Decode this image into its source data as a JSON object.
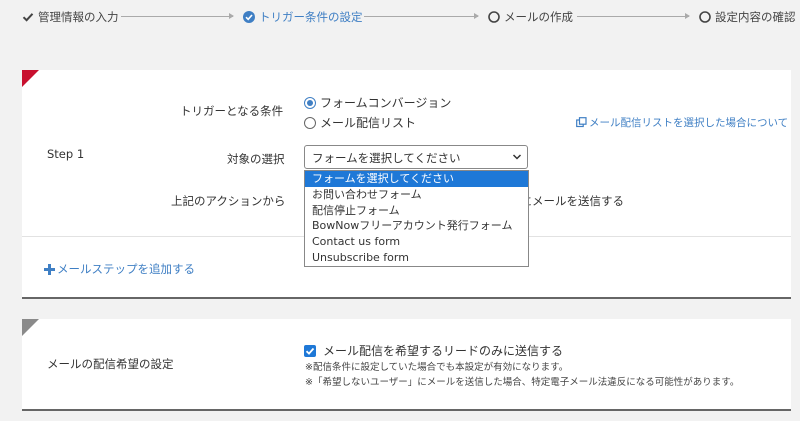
{
  "steps": [
    {
      "label": "管理情報の入力",
      "state": "done",
      "icon": "check-icon"
    },
    {
      "label": "トリガー条件の設定",
      "state": "active",
      "icon": "check-circle-icon"
    },
    {
      "label": "メールの作成",
      "state": "pending",
      "icon": "circle-icon"
    },
    {
      "label": "設定内容の確認",
      "state": "pending",
      "icon": "circle-icon"
    }
  ],
  "step_card": {
    "step_label": "Step 1",
    "trigger_label": "トリガーとなる条件",
    "radio_options": [
      {
        "label": "フォームコンバージョン",
        "checked": true
      },
      {
        "label": "メール配信リスト",
        "checked": false
      }
    ],
    "list_help_link": "メール配信リストを選択した場合について",
    "target_label": "対象の選択",
    "select": {
      "value": "フォームを選択してください",
      "options": [
        "フォームを選択してください",
        "お問い合わせフォーム",
        "配信停止フォーム",
        "BowNowフリーアカウント発行フォーム",
        "Contact us form",
        "Unsubscribe form"
      ]
    },
    "action_label": "上記のアクションから",
    "action_suffix": "）にメールを送信する",
    "add_step_label": "メールステップを追加する"
  },
  "delivery_card": {
    "label": "メールの配信希望の設定",
    "checkbox_label": "メール配信を希望するリードのみに送信する",
    "checked": true,
    "note1": "※配信条件に設定していた場合でも本設定が有効になります。",
    "note2": "※「希望しないユーザー」にメールを送信した場合、特定電子メール法違反になる可能性があります。"
  },
  "colors": {
    "accent": "#3f7fc4",
    "selected": "#1e78d7",
    "corner_red": "#c8102e",
    "corner_grey": "#8a8a8a"
  }
}
